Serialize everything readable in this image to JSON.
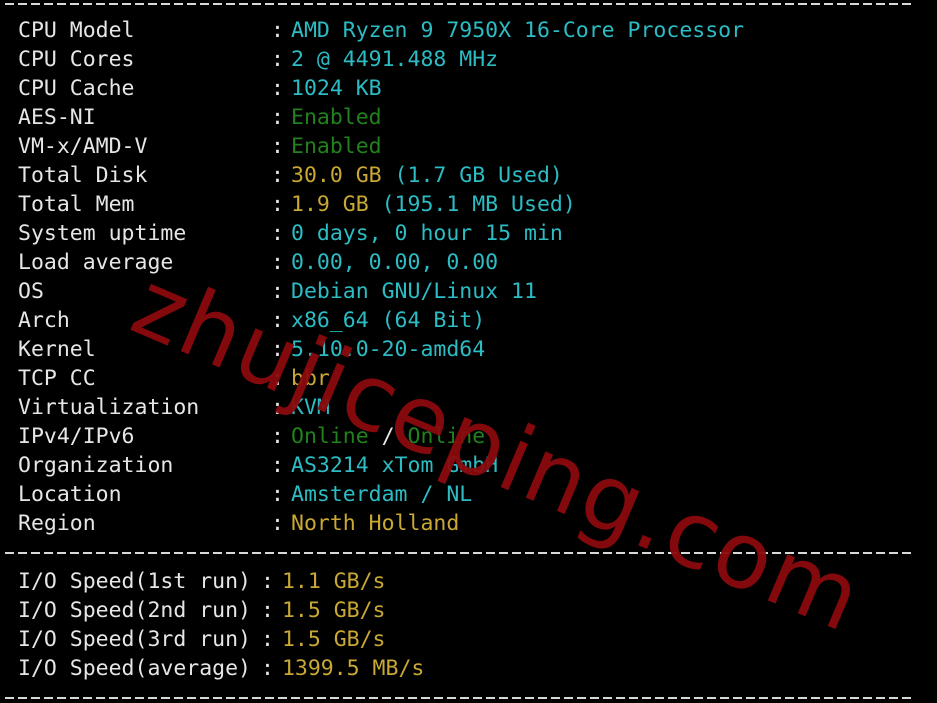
{
  "system_info": [
    {
      "label": "CPU Model",
      "parts": [
        {
          "text": "AMD Ryzen 9 7950X 16-Core Processor",
          "color": "cyan"
        }
      ]
    },
    {
      "label": "CPU Cores",
      "parts": [
        {
          "text": "2 @ 4491.488 MHz",
          "color": "cyan"
        }
      ]
    },
    {
      "label": "CPU Cache",
      "parts": [
        {
          "text": "1024 KB",
          "color": "cyan"
        }
      ]
    },
    {
      "label": "AES-NI",
      "parts": [
        {
          "text": "Enabled",
          "color": "green"
        }
      ]
    },
    {
      "label": "VM-x/AMD-V",
      "parts": [
        {
          "text": "Enabled",
          "color": "green"
        }
      ]
    },
    {
      "label": "Total Disk",
      "parts": [
        {
          "text": "30.0 GB",
          "color": "yellow"
        },
        {
          "text": " (1.7 GB Used)",
          "color": "cyan"
        }
      ]
    },
    {
      "label": "Total Mem",
      "parts": [
        {
          "text": "1.9 GB",
          "color": "yellow"
        },
        {
          "text": " (195.1 MB Used)",
          "color": "cyan"
        }
      ]
    },
    {
      "label": "System uptime",
      "parts": [
        {
          "text": "0 days, 0 hour 15 min",
          "color": "cyan"
        }
      ]
    },
    {
      "label": "Load average",
      "parts": [
        {
          "text": "0.00, 0.00, 0.00",
          "color": "cyan"
        }
      ]
    },
    {
      "label": "OS",
      "parts": [
        {
          "text": "Debian GNU/Linux 11",
          "color": "cyan"
        }
      ]
    },
    {
      "label": "Arch",
      "parts": [
        {
          "text": "x86_64 (64 Bit)",
          "color": "cyan"
        }
      ]
    },
    {
      "label": "Kernel",
      "parts": [
        {
          "text": "5.10.0-20-amd64",
          "color": "cyan"
        }
      ]
    },
    {
      "label": "TCP CC",
      "parts": [
        {
          "text": "bbr",
          "color": "yellow"
        }
      ]
    },
    {
      "label": "Virtualization",
      "parts": [
        {
          "text": "KVM",
          "color": "cyan"
        }
      ]
    },
    {
      "label": "IPv4/IPv6",
      "parts": [
        {
          "text": "Online",
          "color": "green"
        },
        {
          "text": " / ",
          "color": "white"
        },
        {
          "text": "Online",
          "color": "green"
        }
      ]
    },
    {
      "label": "Organization",
      "parts": [
        {
          "text": "AS3214 xTom GmbH",
          "color": "cyan"
        }
      ]
    },
    {
      "label": "Location",
      "parts": [
        {
          "text": "Amsterdam / NL",
          "color": "cyan"
        }
      ]
    },
    {
      "label": "Region",
      "parts": [
        {
          "text": "North Holland",
          "color": "yellow"
        }
      ]
    }
  ],
  "io_speed": [
    {
      "label": "I/O Speed(1st run)",
      "value": "1.1 GB/s"
    },
    {
      "label": "I/O Speed(2nd run)",
      "value": "1.5 GB/s"
    },
    {
      "label": "I/O Speed(3rd run)",
      "value": "1.5 GB/s"
    },
    {
      "label": "I/O Speed(average)",
      "value": "1399.5 MB/s"
    }
  ],
  "separator_char": ":",
  "watermark": "zhujiceping.com",
  "colors": {
    "cyan": "#2cbcc4",
    "yellow": "#c9a834",
    "green": "#21811d",
    "white": "#e6e6e6",
    "watermark": "#8b0a0e",
    "background": "#000000"
  }
}
